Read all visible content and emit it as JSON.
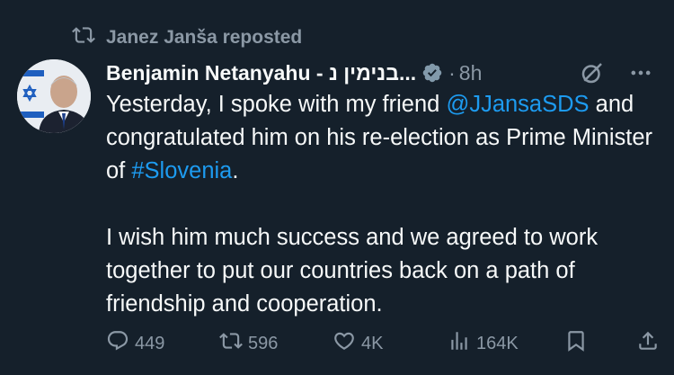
{
  "repost": {
    "text": "Janez Janša reposted"
  },
  "author": {
    "name": "Benjamin Netanyahu - בנימין נ...",
    "verified_color": "#829aab"
  },
  "meta": {
    "separator": "·",
    "timestamp": "8h"
  },
  "tweet": {
    "p1_a": "Yesterday, I spoke with my friend ",
    "mention": "@JJansaSDS",
    "p1_b": " and congratulated him on his re-election as Prime Minister of ",
    "hashtag": "#Slovenia",
    "p1_c": ".",
    "p2": "I wish him much success and we agreed to work together to put our countries back on a path of friendship and cooperation."
  },
  "actions": {
    "replies": "449",
    "reposts": "596",
    "likes": "4K",
    "views": "164K"
  },
  "colors": {
    "background": "#15202b",
    "text": "#f7f9f9",
    "muted": "#8b98a5",
    "link": "#1d9bf0"
  },
  "icons": [
    "repost-icon",
    "verified-badge-icon",
    "grok-icon",
    "more-icon",
    "reply-icon",
    "like-icon",
    "views-icon",
    "bookmark-icon",
    "share-icon"
  ]
}
